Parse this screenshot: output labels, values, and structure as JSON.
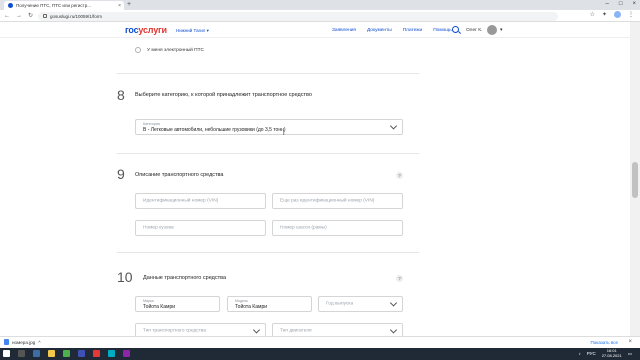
{
  "browser": {
    "tab_title": "Получение ПТС, ПТС или регистр...",
    "tab_close": "×",
    "new_tab": "+",
    "window_controls": [
      "–",
      "□",
      "×"
    ],
    "url": "gosuslugi.ru/10059/1/form",
    "nav_icons": [
      "back-icon",
      "forward-icon",
      "reload-icon"
    ]
  },
  "header": {
    "logo_part1": "гос",
    "logo_part2": "услуги",
    "region": "Нижний Тагил ▾",
    "nav": [
      "Заявления",
      "Документы",
      "Платежи",
      "Помощь"
    ],
    "user_name": "Олег К.",
    "user_chevron": "▾"
  },
  "form": {
    "radio_option_label": "У меня электронный ПТС",
    "step8": {
      "number": "8",
      "title": "Выберите категорию, к которой принадлежит транспортное средство",
      "select_label": "Категория",
      "select_value": "B - Легковые автомобили, небольшие грузовики (до 3,5 тонн)"
    },
    "step9": {
      "number": "9",
      "title": "Описание транспортного средства",
      "help": "?",
      "fields": [
        "Идентификационный номер (VIN)",
        "Еще раз идентификационный номер (VIN)",
        "Номер кузова",
        "Номер шасси (рамы)"
      ]
    },
    "step10": {
      "number": "10",
      "title": "Данные транспортного средства",
      "help": "?",
      "brand_label": "Марка",
      "brand_value": "Тойота Камри",
      "model_label": "Модель",
      "model_value": "Тойота Камри",
      "year_placeholder": "Год выпуска",
      "type_placeholder": "Тип транспортного средства",
      "engine_placeholder": "Тип двигателя"
    }
  },
  "downloads": {
    "file_name": "номера.jpg",
    "show_all": "Показать все",
    "close": "×"
  },
  "taskbar": {
    "lang": "РУС",
    "time": "16:01",
    "date": "27.08.2021"
  },
  "colors": {
    "brand_blue": "#0d4cd3",
    "brand_red": "#e3342f"
  }
}
